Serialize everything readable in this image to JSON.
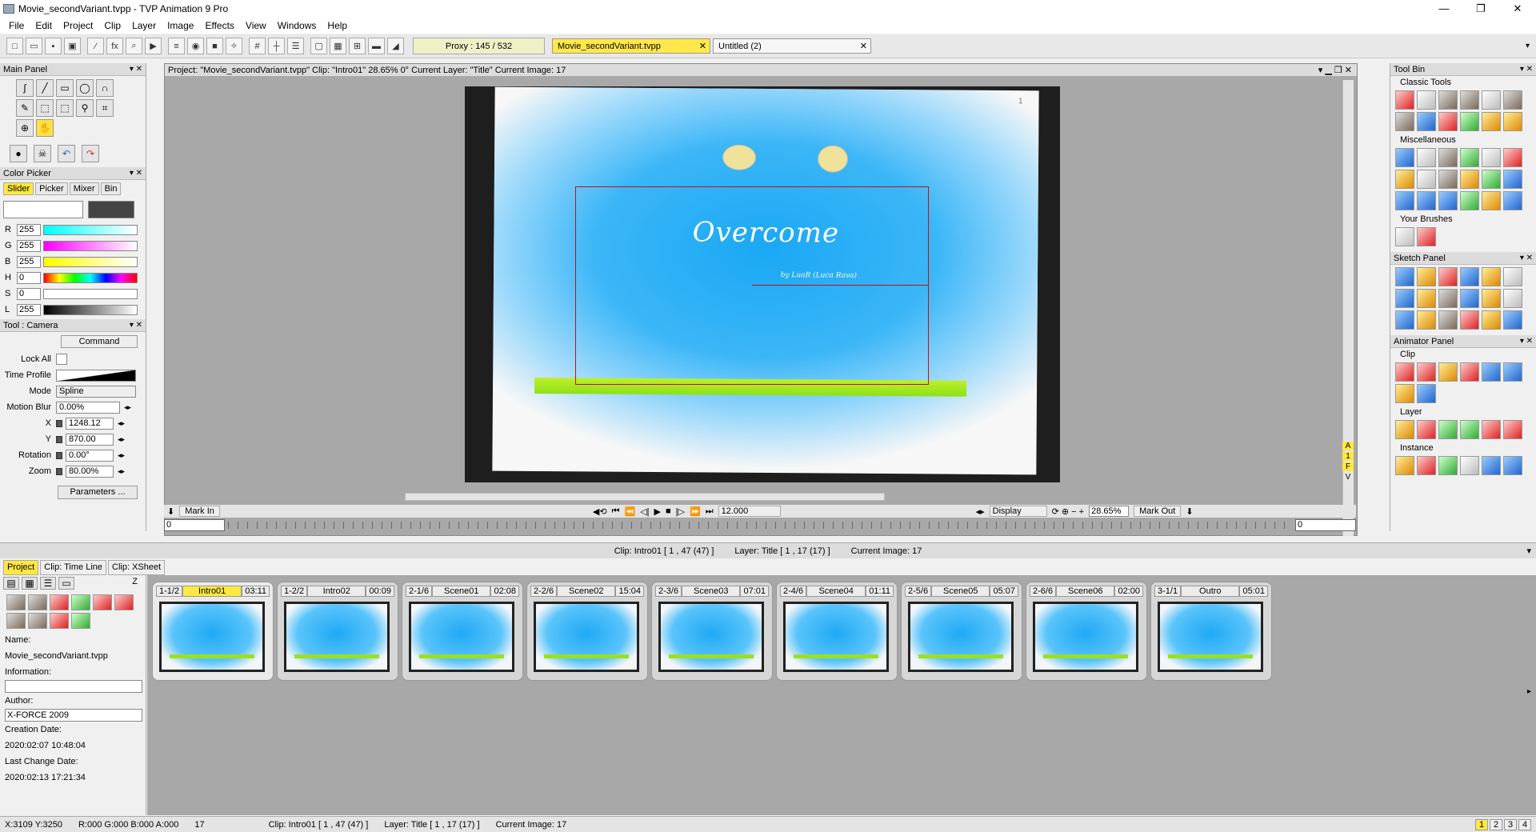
{
  "window": {
    "title": "Movie_secondVariant.tvpp - TVP Animation 9 Pro",
    "min": "—",
    "max": "❐",
    "close": "✕"
  },
  "menu": [
    "File",
    "Edit",
    "Project",
    "Clip",
    "Layer",
    "Image",
    "Effects",
    "View",
    "Windows",
    "Help"
  ],
  "toolbar": {
    "proxy": "Proxy : 145 / 532",
    "tab1": "Movie_secondVariant.tvpp",
    "tab2": "Untitled (2)",
    "tab_close": "✕"
  },
  "main_panel": {
    "title": "Main Panel"
  },
  "color_picker": {
    "title": "Color Picker",
    "tabs": [
      "Slider",
      "Picker",
      "Mixer",
      "Bin"
    ],
    "rows": [
      {
        "label": "R",
        "value": "255"
      },
      {
        "label": "G",
        "value": "255"
      },
      {
        "label": "B",
        "value": "255"
      },
      {
        "label": "H",
        "value": "0"
      },
      {
        "label": "S",
        "value": "0"
      },
      {
        "label": "L",
        "value": "255"
      }
    ]
  },
  "tool_panel": {
    "title": "Tool : Camera",
    "command": "Command",
    "lock_all": "Lock All",
    "time_profile": "Time Profile",
    "mode_label": "Mode",
    "mode": "Spline",
    "motion_blur_label": "Motion Blur",
    "motion_blur": "0.00%",
    "x_label": "X",
    "x": "1248.12",
    "y_label": "Y",
    "y": "870.00",
    "rotation_label": "Rotation",
    "rotation": "0.00°",
    "zoom_label": "Zoom",
    "zoom": "80.00%",
    "parameters": "Parameters ..."
  },
  "viewer": {
    "header": "Project: \"Movie_secondVariant.tvpp\"  Clip: \"Intro01\"  28.65%   0°  Current Layer: \"Title\"  Current Image: 17",
    "canvas_title": "Overcome",
    "canvas_sub": "by LuaR (Luca Rava)",
    "page_num": "1"
  },
  "transport": {
    "mark_in": "Mark In",
    "mark_out": "Mark Out",
    "fps": "12.000",
    "display": "Display",
    "zoom": "28.65%",
    "in_value": "0",
    "out_value": "0",
    "side_letters": [
      "A",
      "1",
      "F",
      "V"
    ]
  },
  "infobar": {
    "clip": "Clip: Intro01 [ 1 , 47  (47) ]",
    "layer": "Layer: Title [ 1 , 17  (17) ]",
    "image": "Current Image: 17"
  },
  "project_tabs": [
    "Project",
    "Clip: Time Line",
    "Clip: XSheet"
  ],
  "project_info": {
    "name_label": "Name:",
    "name": "Movie_secondVariant.tvpp",
    "info_label": "Information:",
    "info": "",
    "author_label": "Author:",
    "author": "X-FORCE 2009",
    "created_label": "Creation Date:",
    "created": "2020:02:07 10:48:04",
    "changed_label": "Last Change Date:",
    "changed": "2020:02:13 17:21:34"
  },
  "clips": [
    {
      "index": "1-1/2",
      "name": "Intro01",
      "dur": "03:11"
    },
    {
      "index": "1-2/2",
      "name": "Intro02",
      "dur": "00:09"
    },
    {
      "index": "2-1/6",
      "name": "Scene01",
      "dur": "02:08"
    },
    {
      "index": "2-2/6",
      "name": "Scene02",
      "dur": "15:04"
    },
    {
      "index": "2-3/6",
      "name": "Scene03",
      "dur": "07:01"
    },
    {
      "index": "2-4/6",
      "name": "Scene04",
      "dur": "01:11"
    },
    {
      "index": "2-5/6",
      "name": "Scene05",
      "dur": "05:07"
    },
    {
      "index": "2-6/6",
      "name": "Scene06",
      "dur": "02:00"
    },
    {
      "index": "3-1/1",
      "name": "Outro",
      "dur": "05:01"
    }
  ],
  "tool_bin": {
    "title": "Tool Bin",
    "classic": "Classic Tools",
    "misc": "Miscellaneous",
    "your": "Your Brushes",
    "sketch": "Sketch Panel",
    "animator": "Animator Panel",
    "clip": "Clip",
    "layer": "Layer",
    "instance": "Instance"
  },
  "status": {
    "coords": "X:3109  Y:3250",
    "rgba": "R:000 G:000 B:000 A:000",
    "frame": "17",
    "clip": "Clip: Intro01 [ 1 , 47  (47) ]",
    "layer": "Layer: Title [ 1 , 17  (17) ]",
    "image": "Current Image: 17",
    "pages": [
      "1",
      "2",
      "3",
      "4"
    ]
  }
}
